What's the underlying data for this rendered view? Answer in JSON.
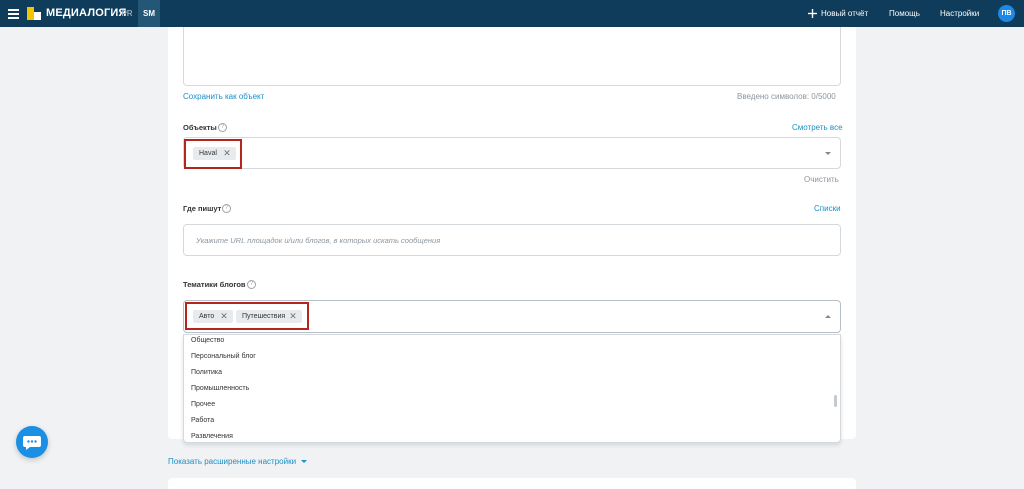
{
  "header": {
    "brand": "МЕДИАЛОГИЯ",
    "tab_pr": "PR",
    "tab_sm": "SM",
    "new_report": "Новый отчёт",
    "help": "Помощь",
    "settings": "Настройки",
    "avatar_initials": "ПВ",
    "bg_color": "#0e3c5a"
  },
  "query": {
    "save_as_object": "Сохранить как объект",
    "char_count": "Введено символов: 0/5000"
  },
  "objects": {
    "label": "Объекты",
    "view_all": "Смотреть все",
    "chips": [
      "Haval"
    ],
    "clear": "Очистить"
  },
  "where": {
    "label": "Где пишут",
    "lists": "Списки",
    "placeholder": "Укажите URL площадок и/или блогов, в которых искать сообщения"
  },
  "topics": {
    "label": "Тематики блогов",
    "chips": [
      "Авто",
      "Путешествия"
    ],
    "options": [
      "Общество",
      "Персональный блог",
      "Политика",
      "Промышленность",
      "Прочее",
      "Работа",
      "Развлечения"
    ]
  },
  "footer": {
    "show_advanced": "Показать расширенные настройки"
  },
  "help_glyph": "?",
  "remove_glyph": "✕"
}
